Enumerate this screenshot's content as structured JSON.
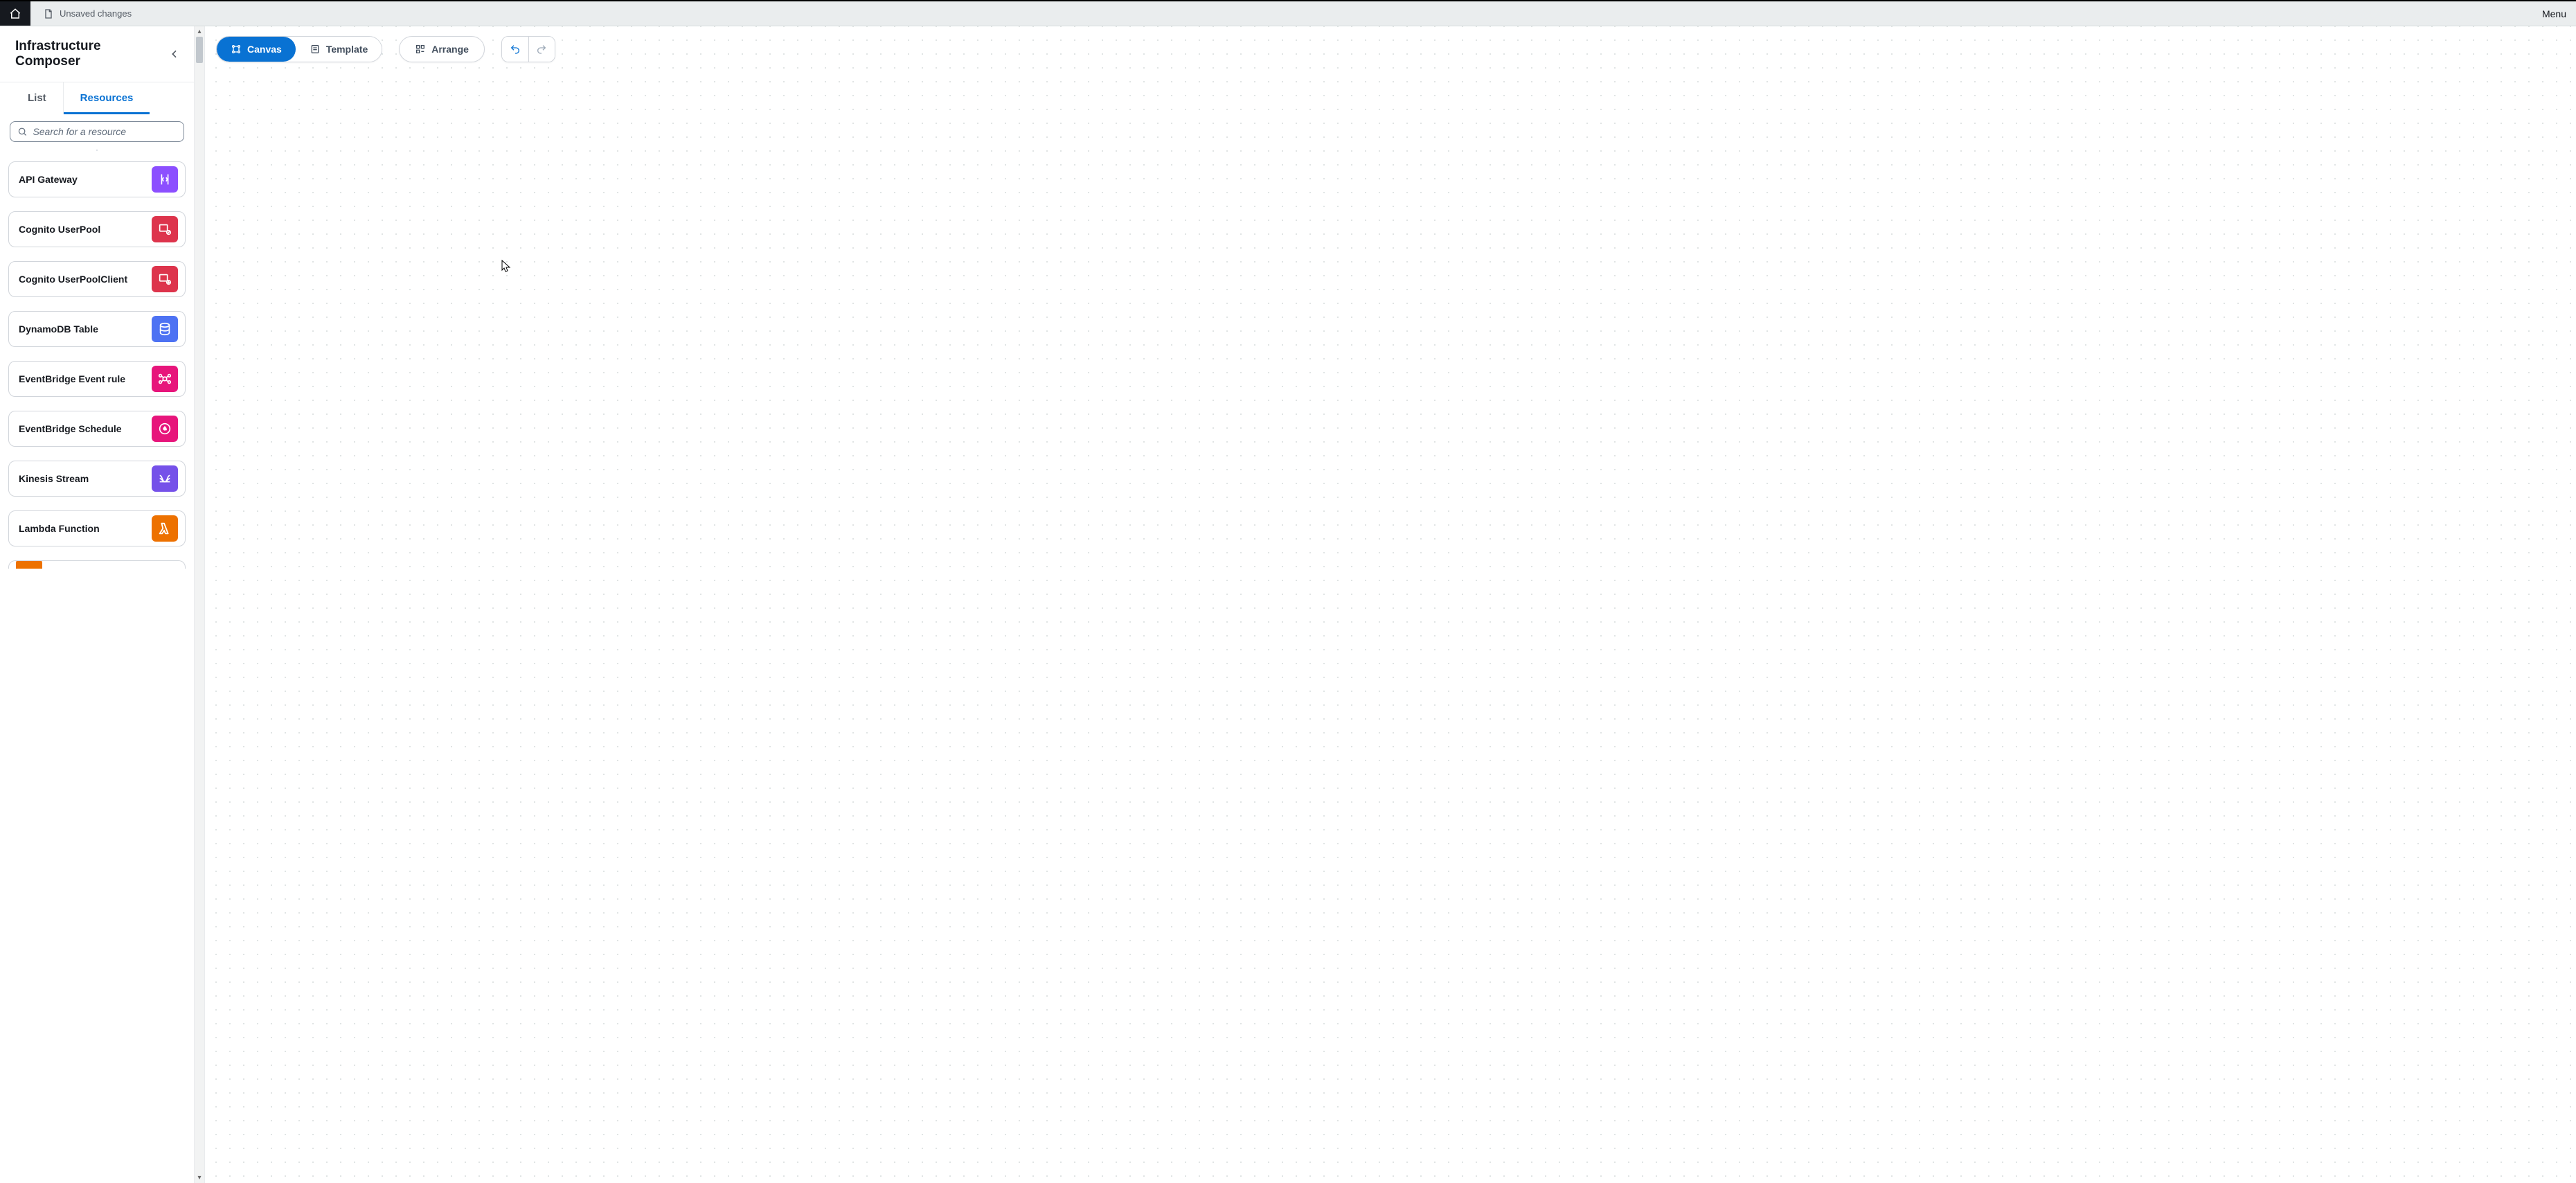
{
  "topbar": {
    "status_label": "Unsaved changes",
    "menu_label": "Menu"
  },
  "sidebar": {
    "title": "Infrastructure Composer",
    "tabs": {
      "list": "List",
      "resources": "Resources"
    },
    "search_placeholder": "Search for a resource",
    "resources": [
      {
        "label": "API Gateway",
        "icon": "api-gateway-icon",
        "color": "purple"
      },
      {
        "label": "Cognito UserPool",
        "icon": "cognito-icon",
        "color": "red"
      },
      {
        "label": "Cognito UserPoolClient",
        "icon": "cognito-client-icon",
        "color": "red"
      },
      {
        "label": "DynamoDB Table",
        "icon": "dynamodb-icon",
        "color": "blue"
      },
      {
        "label": "EventBridge Event rule",
        "icon": "eventbridge-rule-icon",
        "color": "pink"
      },
      {
        "label": "EventBridge Schedule",
        "icon": "eventbridge-sched-icon",
        "color": "pink"
      },
      {
        "label": "Kinesis Stream",
        "icon": "kinesis-icon",
        "color": "violet"
      },
      {
        "label": "Lambda Function",
        "icon": "lambda-icon",
        "color": "orange"
      }
    ]
  },
  "toolbar": {
    "canvas": "Canvas",
    "template": "Template",
    "arrange": "Arrange"
  }
}
